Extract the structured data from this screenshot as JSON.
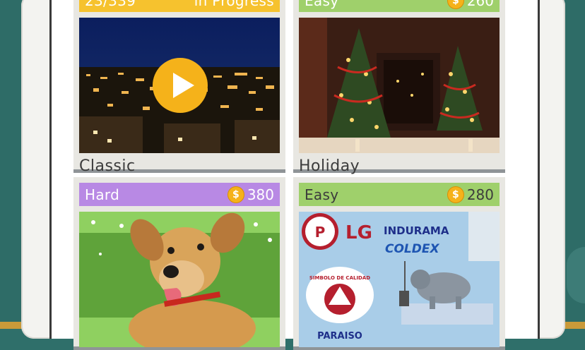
{
  "cards": [
    {
      "id": "classic",
      "header_left": "23/339",
      "header_right": "in Progress",
      "title": "Classic",
      "header_color": "#f6c22e"
    },
    {
      "id": "holiday",
      "header_left": "Easy",
      "coins": "260",
      "title": "Holiday",
      "header_color": "#9fd06b"
    },
    {
      "id": "dog",
      "header_left": "Hard",
      "coins": "380",
      "title": "",
      "header_color": "#b889e4"
    },
    {
      "id": "brands",
      "header_left": "Easy",
      "coins": "280",
      "title": "",
      "header_color": "#9fd06b"
    }
  ],
  "coin_symbol": "$",
  "brand_texts": {
    "lg": "LG",
    "indurama": "INDURAMA",
    "coldex": "COLDEX",
    "paraiso": "PARAISO",
    "simbolo": "SIMBOLO DE CALIDAD",
    "ppp": "P"
  }
}
